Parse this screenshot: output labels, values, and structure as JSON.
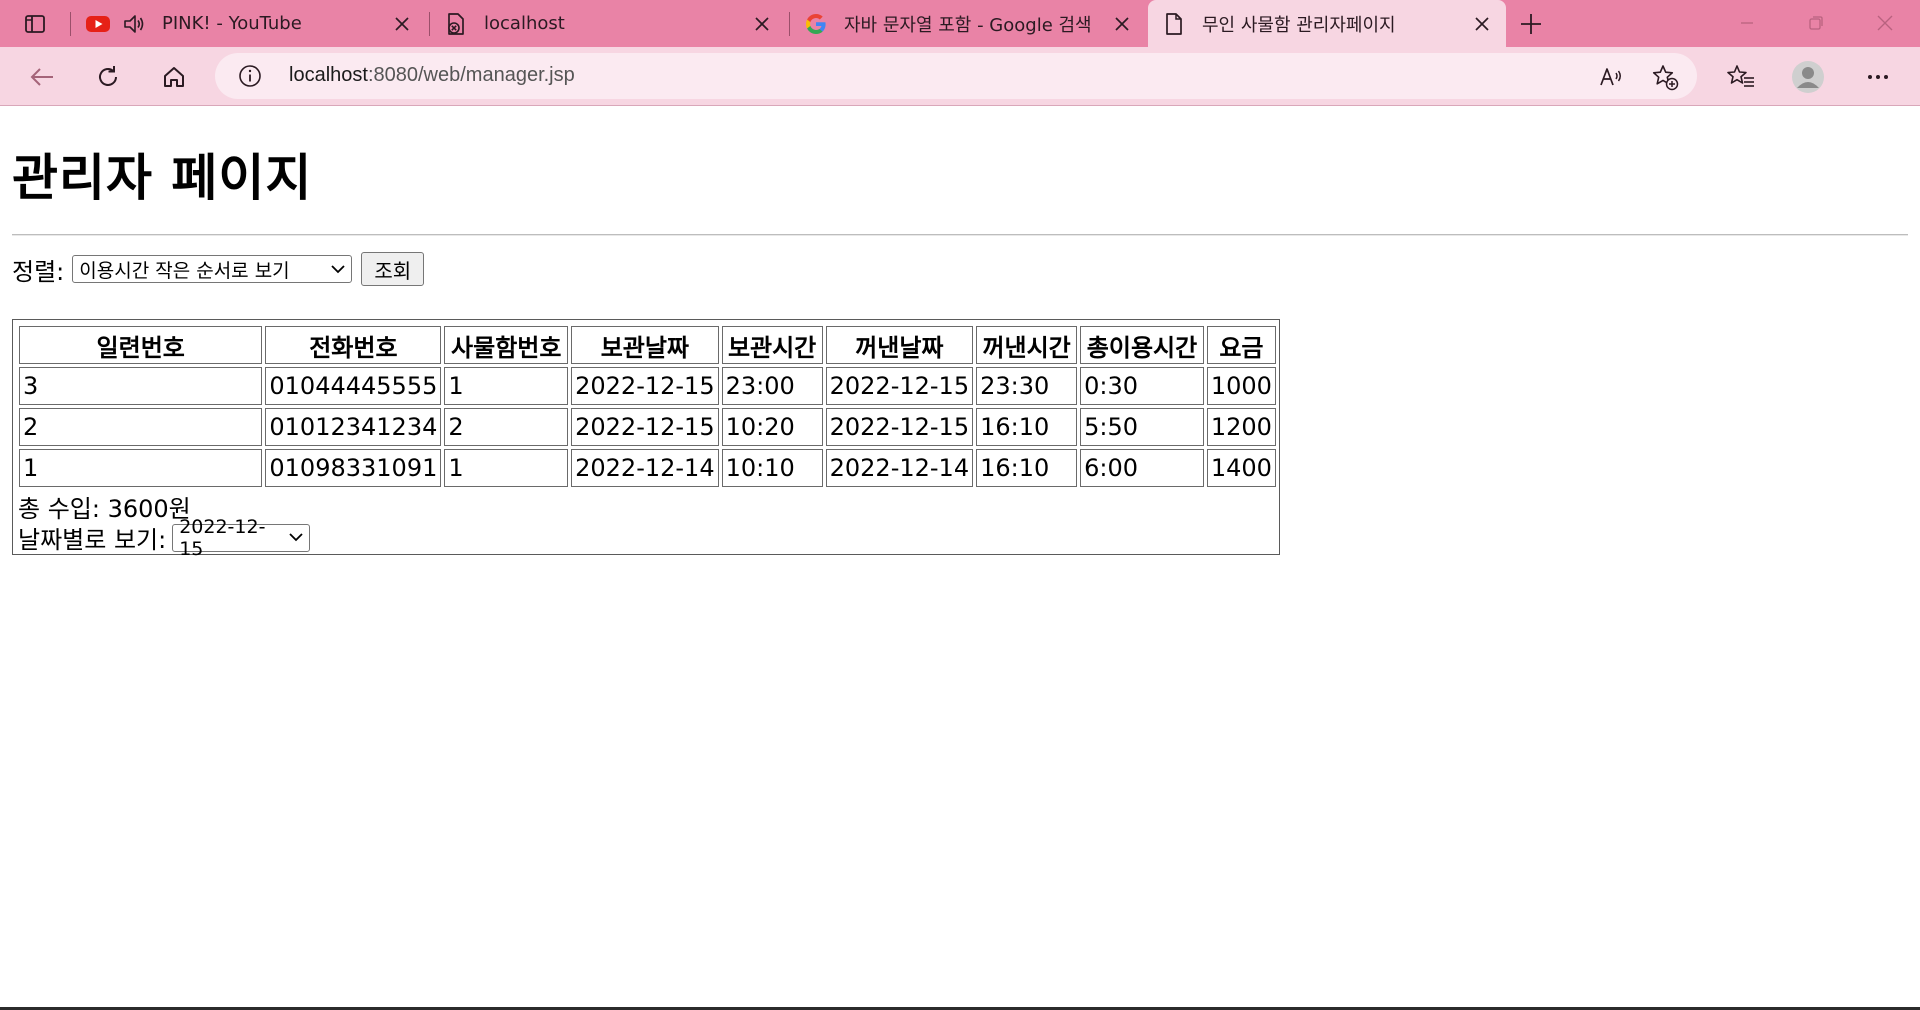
{
  "browser": {
    "tabs": [
      {
        "title": "PINK! - YouTube",
        "favicon": "youtube-icon",
        "audio": true
      },
      {
        "title": "localhost",
        "favicon": "page-error-icon"
      },
      {
        "title": "자바 문자열 포함 - Google 검색",
        "favicon": "google-icon"
      },
      {
        "title": "무인 사물함 관리자페이지",
        "favicon": "document-icon",
        "active": true
      }
    ],
    "address": {
      "host": "localhost",
      "rest": ":8080/web/manager.jsp"
    },
    "accent": "#e983a6",
    "toolbar_bg": "#f7d6e2"
  },
  "page": {
    "title": "관리자 페이지",
    "sort_label": "정렬:",
    "sort_selected": "이용시간 작은 순서로 보기",
    "query_button": "조회",
    "table": {
      "headers": [
        "일련번호",
        "전화번호",
        "사물함번호",
        "보관날짜",
        "보관시간",
        "꺼낸날짜",
        "꺼낸시간",
        "총이용시간",
        "요금"
      ],
      "rows": [
        [
          "3",
          "01044445555",
          "1",
          "2022-12-15",
          "23:00",
          "2022-12-15",
          "23:30",
          "0:30",
          "1000"
        ],
        [
          "2",
          "01012341234",
          "2",
          "2022-12-15",
          "10:20",
          "2022-12-15",
          "16:10",
          "5:50",
          "1200"
        ],
        [
          "1",
          "01098331091",
          "1",
          "2022-12-14",
          "10:10",
          "2022-12-14",
          "16:10",
          "6:00",
          "1400"
        ]
      ]
    },
    "total_income": "총 수입: 3600원",
    "date_view_label": "날짜별로 보기:",
    "date_selected": "2022-12-15"
  }
}
